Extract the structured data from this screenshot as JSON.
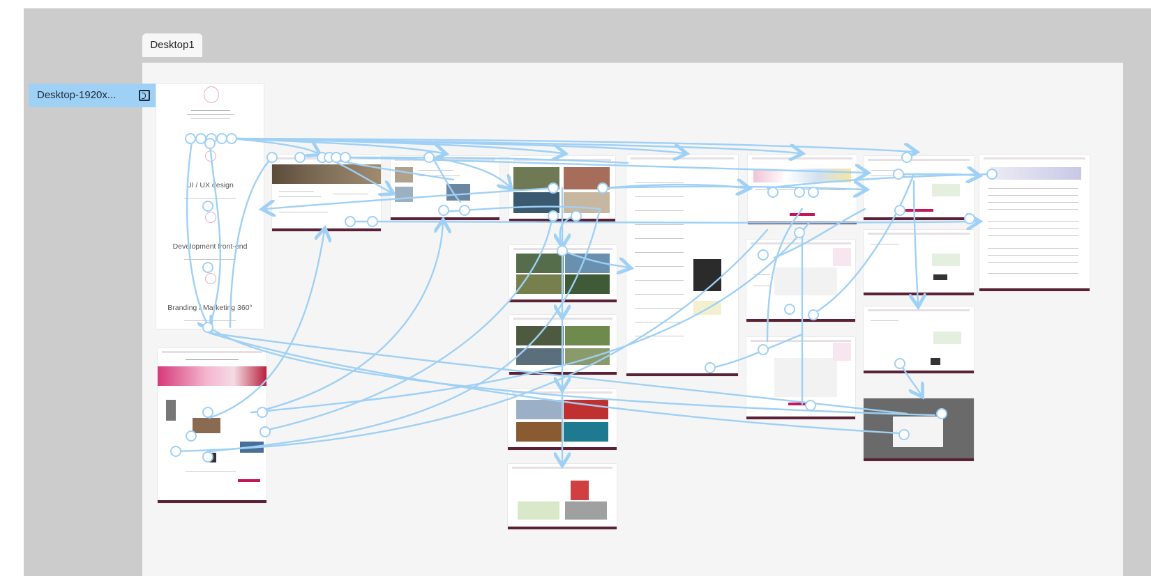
{
  "canvas": {
    "section_title": "Desktop1",
    "start_frame_label": "Desktop-1920x..."
  },
  "home_screen": {
    "panels": [
      "UI / UX design",
      "Development front-end",
      "Branding / Marketing 360°"
    ]
  },
  "colors": {
    "canvas_bg": "#cccccc",
    "section_bg": "#f5f5f5",
    "flow_line": "#9fd0f5",
    "footer_bar": "#5b2237",
    "accent": "#c2185b"
  },
  "icons": {
    "frame_badge": "prototype-start-icon"
  }
}
